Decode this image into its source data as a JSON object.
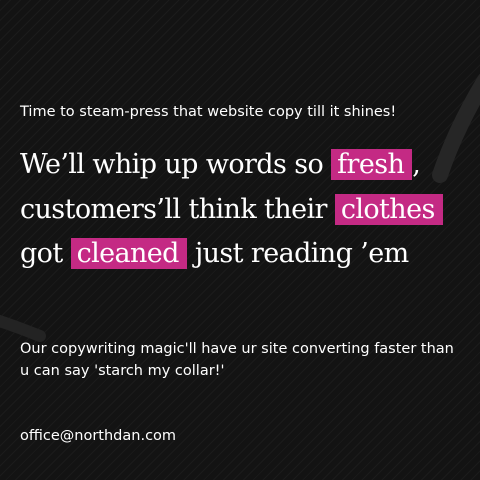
{
  "tagline": "Time to steam-press that website copy till it shines!",
  "headline": {
    "part1": "We’ll whip up words so ",
    "highlight1": "fresh",
    "part2": ", customers’ll think their ",
    "highlight2": "clothes",
    "part3": " got ",
    "highlight3": "cleaned",
    "part4": " just reading ’em"
  },
  "body_text": "Our copywriting magic'll have ur site converting faster than u can say 'starch my collar!'",
  "contact": {
    "email": "office@northdan.com"
  },
  "colors": {
    "background": "#141414",
    "highlight": "#c42a84",
    "text": "#ffffff"
  }
}
